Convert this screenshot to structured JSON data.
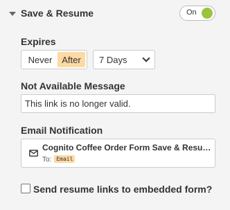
{
  "section": {
    "title": "Save & Resume",
    "toggle_label": "On",
    "toggle_state": "on",
    "toggle_color": "#9bc33f"
  },
  "expires": {
    "label": "Expires",
    "options": [
      "Never",
      "After"
    ],
    "selected": "After",
    "duration": "7 Days"
  },
  "not_available": {
    "label": "Not Available Message",
    "value": "This link is no longer valid."
  },
  "email_notification": {
    "label": "Email Notification",
    "title": "Cognito Coffee Order Form Save & Resume",
    "to_label": "To:",
    "to_tag": "Email",
    "icon": "envelope-icon"
  },
  "embedded": {
    "label": "Send resume links to embedded form?",
    "checked": false
  },
  "colors": {
    "accent_highlight": "#fdd9a3",
    "background": "#f4f4f4"
  }
}
